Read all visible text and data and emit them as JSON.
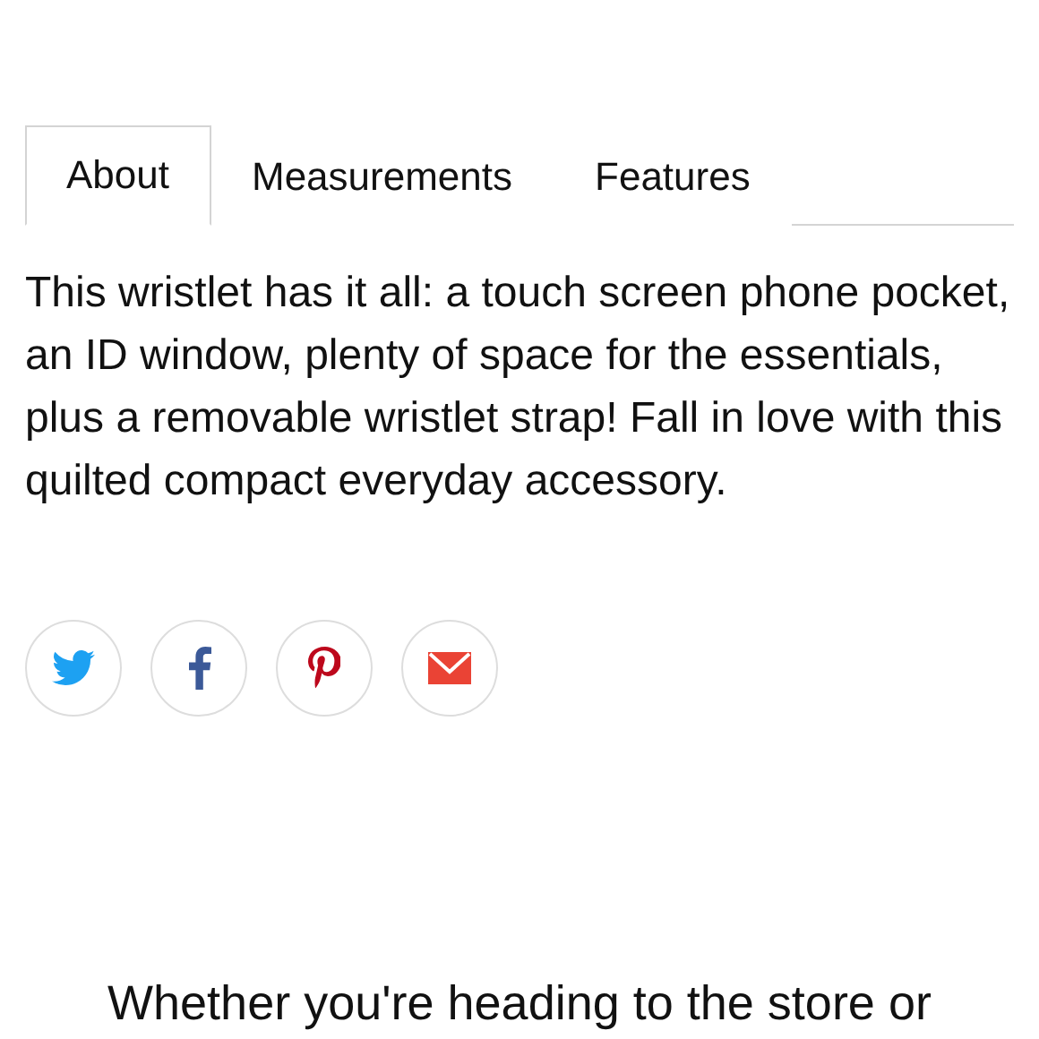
{
  "tabs": [
    {
      "label": "About",
      "selected": true
    },
    {
      "label": "Measurements",
      "selected": false
    },
    {
      "label": "Features",
      "selected": false
    }
  ],
  "description": "This wristlet has it all: a touch screen phone pocket, an ID window, plenty of space for the essentials, plus a removable wristlet strap! Fall in love with this quilted compact everyday accessory.",
  "share_buttons": [
    {
      "kind": "twitter"
    },
    {
      "kind": "facebook"
    },
    {
      "kind": "pinterest"
    },
    {
      "kind": "email"
    }
  ],
  "next_section": {
    "heading": "Whether you're heading to the store or"
  }
}
